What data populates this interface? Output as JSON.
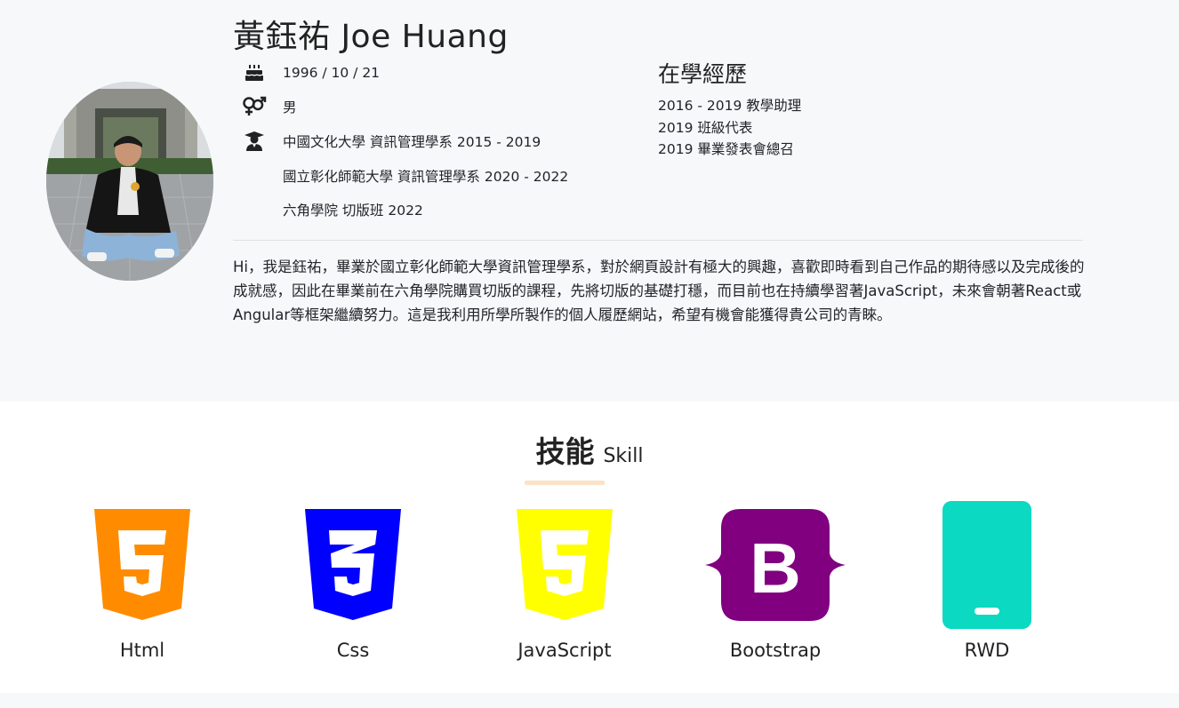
{
  "profile": {
    "name": "黃鈺祐  Joe Huang",
    "birthday": "1996 / 10 / 21",
    "gender": "男",
    "education": [
      "中國文化大學 資訊管理學系 2015 - 2019",
      "國立彰化師範大學 資訊管理學系 2020 - 2022",
      "六角學院 切版班 2022"
    ],
    "icons": {
      "birthday": "cake-icon",
      "gender": "gender-icon",
      "education": "graduate-icon"
    }
  },
  "experience": {
    "title": "在學經歷",
    "items": [
      "2016 - 2019 教學助理",
      "2019 班級代表",
      "2019 畢業發表會總召"
    ]
  },
  "bio": "Hi，我是鈺祐，畢業於國立彰化師範大學資訊管理學系，對於網頁設計有極大的興趣，喜歡即時看到自己作品的期待感以及完成後的成就感，因此在畢業前在六角學院購買切版的課程，先將切版的基礎打穩，而目前也在持續學習著JavaScript，未來會朝著React或Angular等框架繼續努力。這是我利用所學所製作的個人履歷網站，希望有機會能獲得貴公司的青睞。",
  "skills": {
    "title_zh": "技能",
    "title_en": "Skill",
    "items": [
      {
        "label": "Html",
        "icon": "html5-icon",
        "color": "#ff8c00"
      },
      {
        "label": "Css",
        "icon": "css3-icon",
        "color": "#0000ff"
      },
      {
        "label": "JavaScript",
        "icon": "javascript-icon",
        "color": "#ffff00"
      },
      {
        "label": "Bootstrap",
        "icon": "bootstrap-icon",
        "color": "#800080"
      },
      {
        "label": "RWD",
        "icon": "phone-icon",
        "color": "#0bd9c1"
      }
    ]
  },
  "colors": {
    "page_bg": "#f7f8fa",
    "skill_underline": "#fbe3c8"
  }
}
